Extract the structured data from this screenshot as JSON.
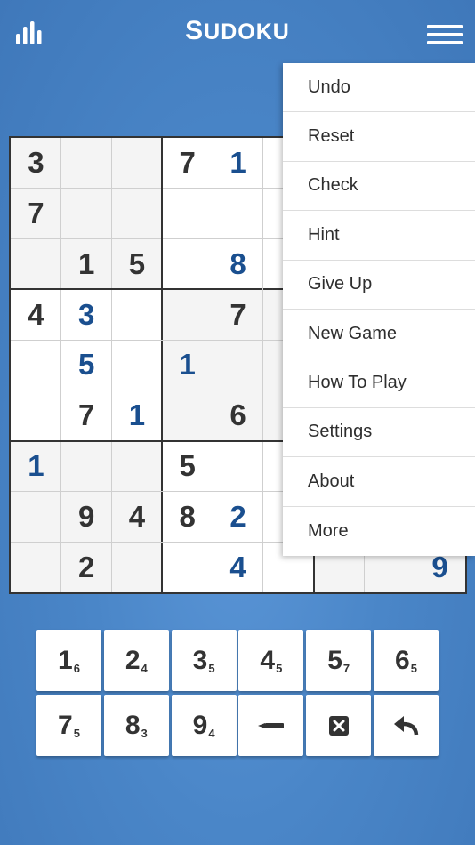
{
  "header": {
    "title_big_s": "S",
    "title_rest": "UDOKU",
    "stats_icon": "bar-chart-icon",
    "menu_icon": "hamburger-menu-icon"
  },
  "colors": {
    "background": "#4a86c8",
    "given_digit": "#333333",
    "user_digit": "#1a4f8f",
    "highlight_box": "#f4f4f4"
  },
  "grid": {
    "rows": [
      [
        {
          "v": "3",
          "t": "g"
        },
        {
          "v": "",
          "t": ""
        },
        {
          "v": "",
          "t": ""
        },
        {
          "v": "7",
          "t": "g"
        },
        {
          "v": "1",
          "t": "u"
        },
        {
          "v": "",
          "t": ""
        },
        {
          "v": "",
          "t": ""
        },
        {
          "v": "",
          "t": ""
        },
        {
          "v": "",
          "t": ""
        }
      ],
      [
        {
          "v": "7",
          "t": "g"
        },
        {
          "v": "",
          "t": ""
        },
        {
          "v": "",
          "t": ""
        },
        {
          "v": "",
          "t": ""
        },
        {
          "v": "",
          "t": ""
        },
        {
          "v": "",
          "t": ""
        },
        {
          "v": "",
          "t": ""
        },
        {
          "v": "",
          "t": ""
        },
        {
          "v": "",
          "t": ""
        }
      ],
      [
        {
          "v": "",
          "t": ""
        },
        {
          "v": "1",
          "t": "g"
        },
        {
          "v": "5",
          "t": "g"
        },
        {
          "v": "",
          "t": ""
        },
        {
          "v": "8",
          "t": "u"
        },
        {
          "v": "",
          "t": ""
        },
        {
          "v": "",
          "t": ""
        },
        {
          "v": "",
          "t": ""
        },
        {
          "v": "",
          "t": ""
        }
      ],
      [
        {
          "v": "4",
          "t": "g"
        },
        {
          "v": "3",
          "t": "u"
        },
        {
          "v": "",
          "t": ""
        },
        {
          "v": "",
          "t": ""
        },
        {
          "v": "7",
          "t": "g"
        },
        {
          "v": "",
          "t": ""
        },
        {
          "v": "",
          "t": ""
        },
        {
          "v": "",
          "t": ""
        },
        {
          "v": "",
          "t": ""
        }
      ],
      [
        {
          "v": "",
          "t": ""
        },
        {
          "v": "5",
          "t": "u"
        },
        {
          "v": "",
          "t": ""
        },
        {
          "v": "1",
          "t": "u"
        },
        {
          "v": "",
          "t": ""
        },
        {
          "v": "",
          "t": ""
        },
        {
          "v": "",
          "t": ""
        },
        {
          "v": "",
          "t": ""
        },
        {
          "v": "",
          "t": ""
        }
      ],
      [
        {
          "v": "",
          "t": ""
        },
        {
          "v": "7",
          "t": "g"
        },
        {
          "v": "1",
          "t": "u"
        },
        {
          "v": "",
          "t": ""
        },
        {
          "v": "6",
          "t": "g"
        },
        {
          "v": "",
          "t": ""
        },
        {
          "v": "",
          "t": ""
        },
        {
          "v": "",
          "t": ""
        },
        {
          "v": "",
          "t": ""
        }
      ],
      [
        {
          "v": "1",
          "t": "u"
        },
        {
          "v": "",
          "t": ""
        },
        {
          "v": "",
          "t": ""
        },
        {
          "v": "5",
          "t": "g"
        },
        {
          "v": "",
          "t": ""
        },
        {
          "v": "",
          "t": ""
        },
        {
          "v": "",
          "t": ""
        },
        {
          "v": "",
          "t": ""
        },
        {
          "v": "",
          "t": ""
        }
      ],
      [
        {
          "v": "",
          "t": ""
        },
        {
          "v": "9",
          "t": "g"
        },
        {
          "v": "4",
          "t": "g"
        },
        {
          "v": "8",
          "t": "g"
        },
        {
          "v": "2",
          "t": "u"
        },
        {
          "v": "",
          "t": ""
        },
        {
          "v": "",
          "t": ""
        },
        {
          "v": "",
          "t": ""
        },
        {
          "v": "",
          "t": ""
        }
      ],
      [
        {
          "v": "",
          "t": ""
        },
        {
          "v": "2",
          "t": "g"
        },
        {
          "v": "",
          "t": ""
        },
        {
          "v": "",
          "t": ""
        },
        {
          "v": "4",
          "t": "u"
        },
        {
          "v": "",
          "t": ""
        },
        {
          "v": "",
          "t": ""
        },
        {
          "v": "",
          "t": ""
        },
        {
          "v": "9",
          "t": "u"
        }
      ]
    ],
    "shaded_boxes": [
      0,
      2,
      4,
      6,
      8
    ]
  },
  "menu": {
    "items": [
      "Undo",
      "Reset",
      "Check",
      "Hint",
      "Give Up",
      "New Game",
      "How To Play",
      "Settings",
      "About",
      "More"
    ]
  },
  "keypad": {
    "digits": [
      {
        "num": "1",
        "count": "6"
      },
      {
        "num": "2",
        "count": "4"
      },
      {
        "num": "3",
        "count": "5"
      },
      {
        "num": "4",
        "count": "5"
      },
      {
        "num": "5",
        "count": "7"
      },
      {
        "num": "6",
        "count": "5"
      },
      {
        "num": "7",
        "count": "5"
      },
      {
        "num": "8",
        "count": "3"
      },
      {
        "num": "9",
        "count": "4"
      }
    ],
    "tools": [
      "pencil-icon",
      "erase-icon",
      "undo-arrow-icon"
    ]
  }
}
